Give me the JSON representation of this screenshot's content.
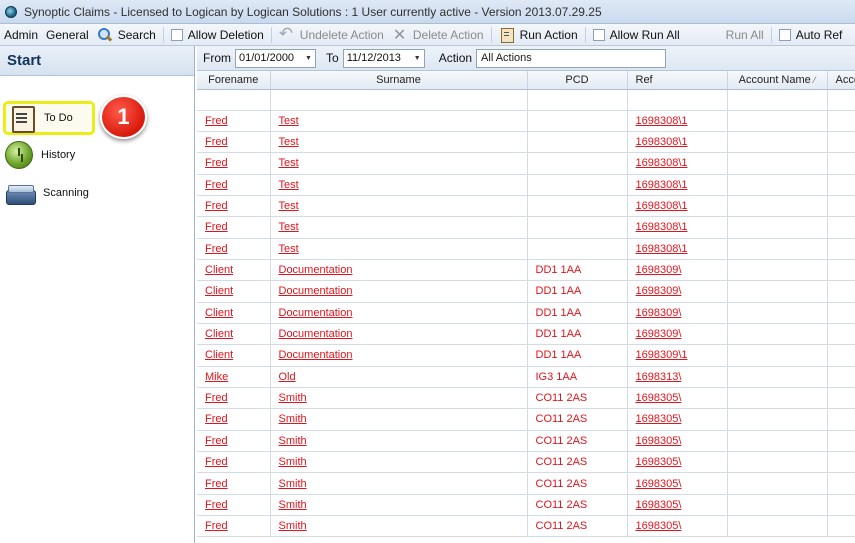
{
  "window": {
    "title": "Synoptic Claims - Licensed to Logican by Logican Solutions : 1 User currently active - Version 2013.07.29.25"
  },
  "menubar": {
    "admin": "Admin",
    "general": "General",
    "search": "Search",
    "allow_deletion": "Allow Deletion",
    "undelete_action": "Undelete Action",
    "delete_action": "Delete Action",
    "run_action": "Run Action",
    "allow_run_all": "Allow Run All",
    "run_all": "Run All",
    "auto_refresh": "Auto Ref"
  },
  "sidebar": {
    "header": "Start",
    "items": [
      {
        "label": "To Do",
        "icon": "clipboard-icon",
        "selected": true
      },
      {
        "label": "History",
        "icon": "clock-icon"
      },
      {
        "label": "Scanning",
        "icon": "scanner-icon"
      }
    ],
    "callout": "1"
  },
  "filter": {
    "from_label": "From",
    "from_value": "01/01/2000",
    "to_label": "To",
    "to_value": "11/12/2013",
    "action_label": "Action",
    "action_value": "All Actions"
  },
  "grid": {
    "columns": [
      "Forename",
      "Surname",
      "PCD",
      "Ref",
      "Account Name",
      "Acco"
    ],
    "sort_indicator": "⁄",
    "rows": [
      {
        "forename": "Fred",
        "surname": "Test",
        "pcd": "",
        "ref": "1698308\\1"
      },
      {
        "forename": "Fred",
        "surname": "Test",
        "pcd": "",
        "ref": "1698308\\1"
      },
      {
        "forename": "Fred",
        "surname": "Test",
        "pcd": "",
        "ref": "1698308\\1"
      },
      {
        "forename": "Fred",
        "surname": "Test",
        "pcd": "",
        "ref": "1698308\\1"
      },
      {
        "forename": "Fred",
        "surname": "Test",
        "pcd": "",
        "ref": "1698308\\1"
      },
      {
        "forename": "Fred",
        "surname": "Test",
        "pcd": "",
        "ref": "1698308\\1"
      },
      {
        "forename": "Fred",
        "surname": "Test",
        "pcd": "",
        "ref": "1698308\\1"
      },
      {
        "forename": "Client",
        "surname": "Documentation",
        "pcd": "DD1 1AA",
        "ref": "1698309\\"
      },
      {
        "forename": "Client",
        "surname": "Documentation",
        "pcd": "DD1 1AA",
        "ref": "1698309\\"
      },
      {
        "forename": "Client",
        "surname": "Documentation",
        "pcd": "DD1 1AA",
        "ref": "1698309\\"
      },
      {
        "forename": "Client",
        "surname": "Documentation",
        "pcd": "DD1 1AA",
        "ref": "1698309\\"
      },
      {
        "forename": "Client",
        "surname": "Documentation",
        "pcd": "DD1 1AA",
        "ref": "1698309\\1"
      },
      {
        "forename": "Mike",
        "surname": "Old",
        "pcd": "IG3 1AA",
        "ref": "1698313\\"
      },
      {
        "forename": "Fred",
        "surname": "Smith",
        "pcd": "CO11 2AS",
        "ref": "1698305\\"
      },
      {
        "forename": "Fred",
        "surname": "Smith",
        "pcd": "CO11 2AS",
        "ref": "1698305\\"
      },
      {
        "forename": "Fred",
        "surname": "Smith",
        "pcd": "CO11 2AS",
        "ref": "1698305\\"
      },
      {
        "forename": "Fred",
        "surname": "Smith",
        "pcd": "CO11 2AS",
        "ref": "1698305\\"
      },
      {
        "forename": "Fred",
        "surname": "Smith",
        "pcd": "CO11 2AS",
        "ref": "1698305\\"
      },
      {
        "forename": "Fred",
        "surname": "Smith",
        "pcd": "CO11 2AS",
        "ref": "1698305\\"
      },
      {
        "forename": "Fred",
        "surname": "Smith",
        "pcd": "CO11 2AS",
        "ref": "1698305\\"
      }
    ]
  },
  "colors": {
    "link": "#e2141d",
    "highlight": "#ecec16",
    "callout": "#d81a0c"
  }
}
